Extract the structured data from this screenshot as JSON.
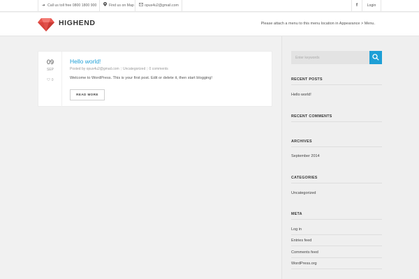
{
  "topbar": {
    "phone": "Call us toll free 0800 1800 900",
    "map": "Find us on Map",
    "email": "opus4u2@gmail.com",
    "facebook_glyph": "f",
    "login": "Login"
  },
  "header": {
    "brand": "HIGHEND",
    "menu_notice": "Please attach a menu to this menu location in Appearance > Menu."
  },
  "post": {
    "day": "09",
    "month": "SEP",
    "likes": "0",
    "title": "Hello world!",
    "meta_author": "Posted by opus4u2@gmail.com",
    "meta_category": "Uncategorized",
    "meta_comments": "0 comments",
    "excerpt": "Welcome to WordPress. This is your first post. Edit or delete it, then start blogging!",
    "read_more": "READ MORE"
  },
  "sidebar": {
    "search_placeholder": "Enter keywords",
    "recent_posts_title": "RECENT POSTS",
    "recent_posts": [
      "Hello world!"
    ],
    "recent_comments_title": "RECENT COMMENTS",
    "archives_title": "ARCHIVES",
    "archives": [
      "September 2014"
    ],
    "categories_title": "CATEGORIES",
    "categories": [
      "Uncategorized"
    ],
    "meta_title": "META",
    "meta_links": [
      "Log in",
      "Entries feed",
      "Comments feed",
      "WordPress.org"
    ]
  },
  "colors": {
    "accent": "#1e9fd6",
    "logo_red": "#e8554e"
  },
  "icons": {
    "phone": "arrow-right-icon",
    "map": "map-pin-icon",
    "email": "envelope-icon",
    "search": "magnifier-icon",
    "likes": "heart-icon",
    "logo": "gem-icon"
  }
}
